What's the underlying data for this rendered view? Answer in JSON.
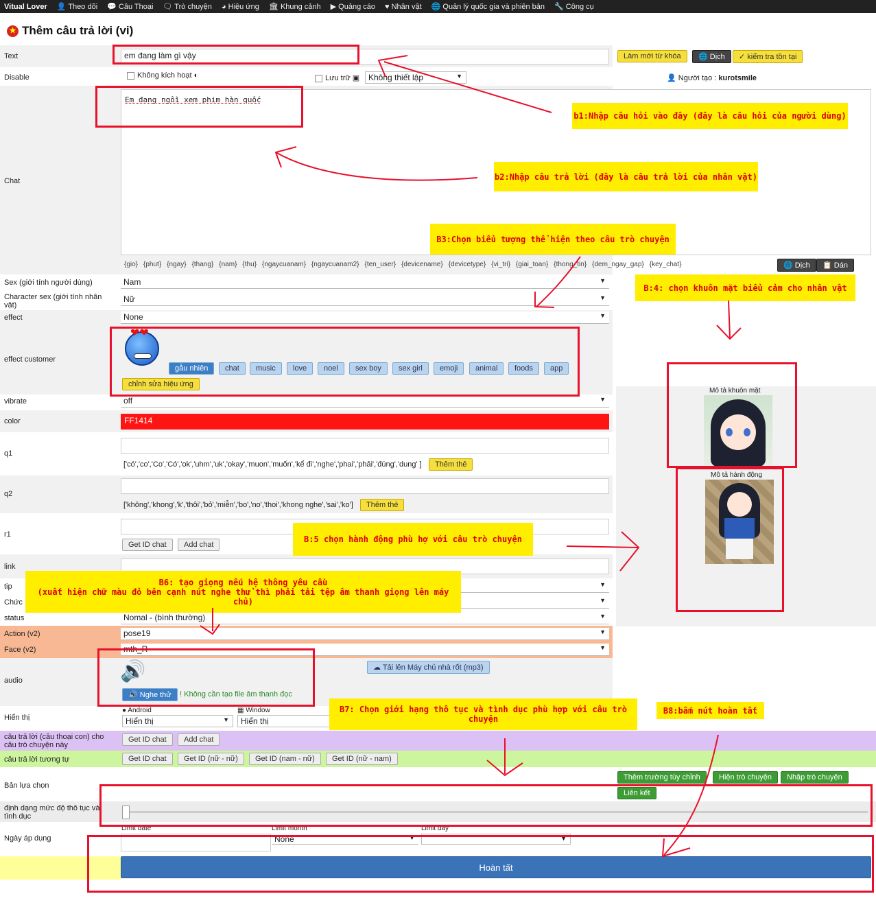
{
  "nav": {
    "brand": "Vitual Lover",
    "items": [
      "Theo dõi",
      "Câu Thoại",
      "Trò chuyện",
      "Hiệu ứng",
      "Khung cảnh",
      "Quảng cáo",
      "Nhân vật",
      "Quản lý quốc gia và phiên bản",
      "Công cụ"
    ]
  },
  "page_title": "Thêm câu trả lời (vi)",
  "form": {
    "text_label": "Text",
    "text_value": "em đang làm gì vậy",
    "refresh_keywords_button": "Làm mới từ khóa",
    "translate_button": "Dịch",
    "check_exists_button": "kiểm tra tồn tại",
    "disable_label": "Disable",
    "disable_checkbox_label": "Không kích hoạt",
    "archive_label": "Lưu trữ",
    "setting_select": "Không thiết lập",
    "creator_label": "Người tạo :",
    "creator_name": "kurotsmile",
    "chat_label": "Chat",
    "chat_value": "Em đang ngồi xem phim hàn quốc",
    "tags": [
      "{gio}",
      "{phut}",
      "{ngay}",
      "{thang}",
      "{nam}",
      "{thu}",
      "{ngaycuanam}",
      "{ngaycuanam2}",
      "{ten_user}",
      "{devicename}",
      "{devicetype}",
      "{vi_tri}",
      "{giai_toan}",
      "{thong_tin}",
      "{dem_ngay_gap}",
      "{key_chat}"
    ],
    "tag_translate_button": "Dịch",
    "paste_button": "Dán",
    "sex_label": "Sex (giới tính người dùng)",
    "sex_value": "Nam",
    "char_sex_label": "Character sex (giới tính nhân vật)",
    "char_sex_value": "Nữ",
    "effect_label": "effect",
    "effect_value": "None",
    "effect_customer_label": "effect customer",
    "effect_tabs": [
      "gẫu nhiên",
      "chat",
      "music",
      "love",
      "noel",
      "sex boy",
      "sex girl",
      "emoji",
      "animal",
      "foods",
      "app"
    ],
    "edit_effect_button": "chỉnh sửa hiệu ứng",
    "vibrate_label": "vibrate",
    "vibrate_value": "off",
    "color_label": "color",
    "color_value": "FF1414",
    "q1_label": "q1",
    "q1_tags": "['có','co','Co','Có','ok','uhm','uk','okay','muon','muốn','kể đi','nghe','phai','phải','đúng','dung' ]",
    "add_tag_button": "Thêm thẻ",
    "q2_label": "q2",
    "q2_tags": "['không','khong','k','thôi','bỏ','miễn','bo','no','thoi','khong nghe','sai','ko']",
    "r1_label": "r1",
    "get_id_chat": "Get ID chat",
    "add_chat": "Add chat",
    "link_label": "link",
    "tip_label": "tip",
    "function_label": "Chức",
    "status_label": "status",
    "status_value": "Nomal - (bình thường)",
    "action_label": "Action (v2)",
    "action_value": "pose19",
    "face_label": "Face (v2)",
    "face_value": "mth_R",
    "audio_label": "audio",
    "upload_button": "Tải lên Máy chủ nhà rốt (mp3)",
    "listen_button": "Nghe thử",
    "no_audio_note": "Không cần tạo file âm thanh đọc",
    "display_label": "Hiển thị",
    "android_label": "Android",
    "window_label": "Window",
    "display_value_1": "Hiển thị",
    "display_value_2": "Hiển thị",
    "sub_reply_label": "câu trả lời (câu thoại con) cho câu trò chuyện này",
    "similar_label": "câu trả lời tương tự",
    "get_id_f_f": "Get ID (nữ - nữ)",
    "get_id_m_f": "Get ID (nam - nữ)",
    "get_id_f_m": "Get ID (nữ - nam)",
    "choice_label": "Bản lựa chọn",
    "custom_field_button": "Thêm trường tùy chỉnh",
    "show_chat_button": "Hiện trò chuyện",
    "import_chat_button": "Nhập trò chuyện",
    "link_button": "Liên kết",
    "vulgar_label": "định dạng mức độ thô tục và tình dục",
    "apply_date_label": "Ngày áp dụng",
    "limit_date": "Limit date",
    "limit_month": "Limit month",
    "limit_month_value": "None",
    "limit_day": "Limit day",
    "submit_button": "Hoàn tất",
    "face_desc": "Mô tả khuôn mặt",
    "action_desc": "Mô tả hành động"
  },
  "notes": {
    "b1": "b1:Nhập câu hỏi vào đây (đây là câu hỏi của người dùng)",
    "b2": "b2:Nhập câu trả lời (đây là câu trả lời của nhân vật)",
    "b3": "B3:Chọn biểu tượng thể hiện theo câu trò chuyện",
    "b4": "B:4: chọn khuôn mặt biểu cảm cho nhân vật",
    "b5": "B:5 chọn hành động phù hợ với câu trò chuyện",
    "b6_line1": "B6: tạo giọng nếu hệ thông yêu cầu",
    "b6_line2": "(xuất hiện chữ màu đỏ bên cạnh nút nghe thử thì phải tải tệp âm thanh giọng lên máy chủ)",
    "b7": "B7: Chọn giới hạng thô tục và tình dục phù hợp với câu trò chuyện",
    "b8": "B8:bấm nút hoàn tất"
  },
  "colors": {
    "accent_red": "#e8102a",
    "note_bg": "#ffee00",
    "submit_blue": "#3b73b9"
  }
}
